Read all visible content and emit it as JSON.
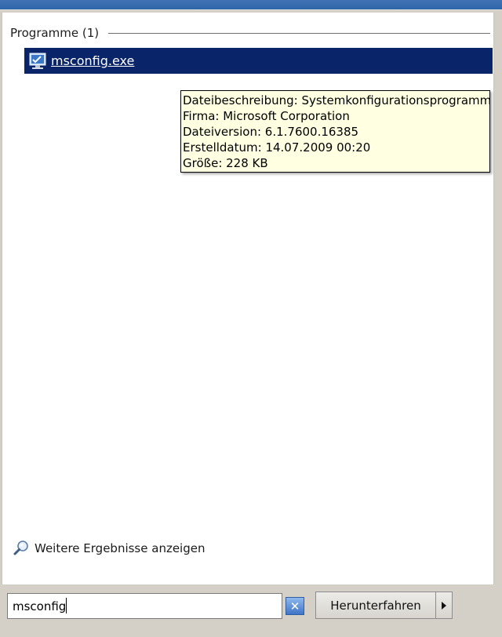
{
  "results": {
    "section_header": "Programme (1)",
    "items": [
      {
        "label": "msconfig.exe",
        "icon": "msconfig-app-icon"
      }
    ],
    "more_results": "Weitere Ergebnisse anzeigen"
  },
  "tooltip": {
    "lines": [
      "Dateibeschreibung: Systemkonfigurationsprogramm",
      "Firma: Microsoft Corporation",
      "Dateiversion: 6.1.7600.16385",
      "Erstelldatum: 14.07.2009 00:20",
      "Größe: 228 KB"
    ]
  },
  "search": {
    "value": "msconfig",
    "clear_icon": "✕"
  },
  "shutdown": {
    "label": "Herunterfahren",
    "arrow_icon": "arrow-right-icon"
  },
  "colors": {
    "selection": "#0a246a",
    "tooltip_bg": "#ffffe1",
    "panel_bg": "#ffffff",
    "frame_bg": "#d4d0c8"
  }
}
